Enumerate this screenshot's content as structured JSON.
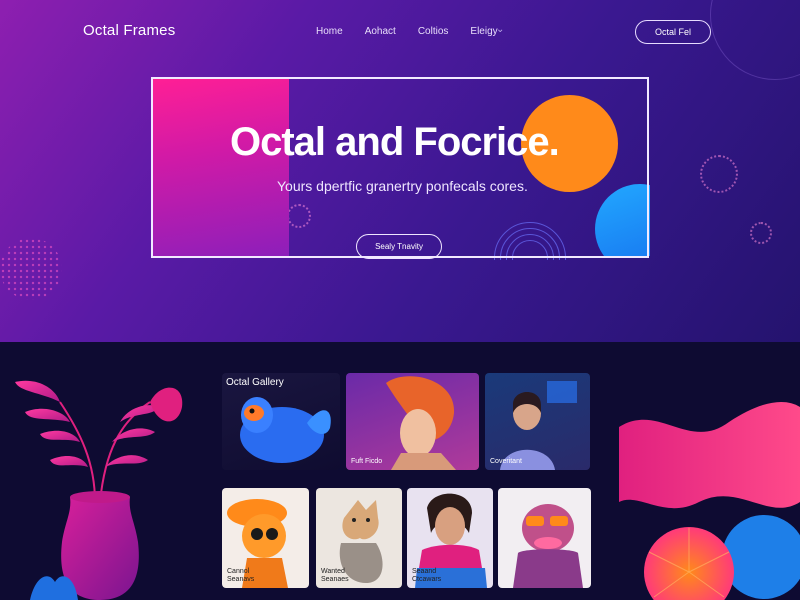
{
  "brand": {
    "name": "Octal Frames"
  },
  "nav": {
    "links": [
      "Home",
      "Aohact",
      "Coltios",
      "Eleigy"
    ],
    "cta_label": "Octal Fel"
  },
  "hero": {
    "title": "Octal and Focrice.",
    "subtitle": "Yours dpertfic granertry ponfecals cores.",
    "button_label": "Sealy Tnavity"
  },
  "gallery": {
    "title": "Octal Gallery",
    "row1": [
      {
        "caption": ""
      },
      {
        "caption": "Fuft Ficdo"
      },
      {
        "caption": "Coveritant"
      }
    ],
    "row2": [
      {
        "caption": "Cannol\nSeanavs"
      },
      {
        "caption": "Wanted\nSeanaes"
      },
      {
        "caption": "Seaand\nCtcawars"
      },
      {
        "caption": ""
      }
    ]
  },
  "colors": {
    "accent_pink": "#ff1f95",
    "accent_orange": "#ff8a1a",
    "accent_blue": "#22a8ff",
    "hero_bg": "#4a1a9a",
    "bottom_bg": "#0e0b32"
  }
}
